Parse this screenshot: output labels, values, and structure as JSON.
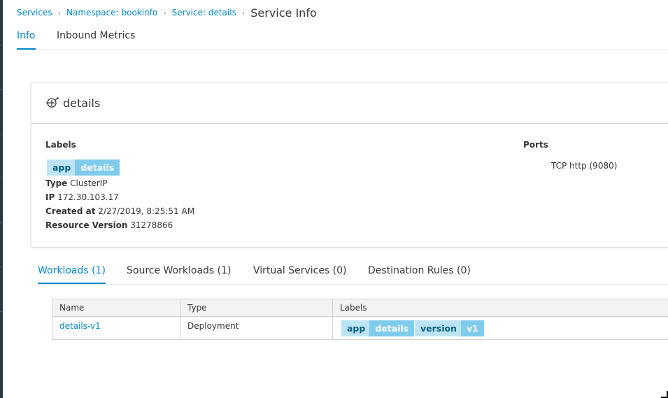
{
  "breadcrumb": {
    "items": [
      "Services",
      "Namespace: bookinfo",
      "Service: details"
    ],
    "current": "Service Info"
  },
  "tabs": {
    "info": "Info",
    "inbound_metrics": "Inbound Metrics"
  },
  "service": {
    "icon": "service-icon",
    "name": "details",
    "labels_title": "Labels",
    "labels": [
      {
        "key": "app",
        "value": "details"
      }
    ],
    "type_label": "Type",
    "type_value": "ClusterIP",
    "ip_label": "IP",
    "ip_value": "172.30.103.17",
    "created_label": "Created at",
    "created_value": "2/27/2019, 8:25:51 AM",
    "resource_version_label": "Resource Version",
    "resource_version_value": "31278866",
    "ports_title": "Ports",
    "ports_value": "TCP http (9080)"
  },
  "detail_tabs": {
    "workloads": "Workloads (1)",
    "source_workloads": "Source Workloads (1)",
    "virtual_services": "Virtual Services (0)",
    "destination_rules": "Destination Rules (0)"
  },
  "workloads_table": {
    "columns": [
      "Name",
      "Type",
      "Labels"
    ],
    "rows": [
      {
        "name": "details-v1",
        "type": "Deployment",
        "labels": [
          {
            "key": "app",
            "value": "details"
          },
          {
            "key": "version",
            "value": "v1"
          }
        ]
      }
    ]
  },
  "colors": {
    "link": "#0088ce",
    "label_key_bg": "#bde4f4",
    "label_value_bg": "#7fcbec",
    "nav_bar": "#283845"
  }
}
